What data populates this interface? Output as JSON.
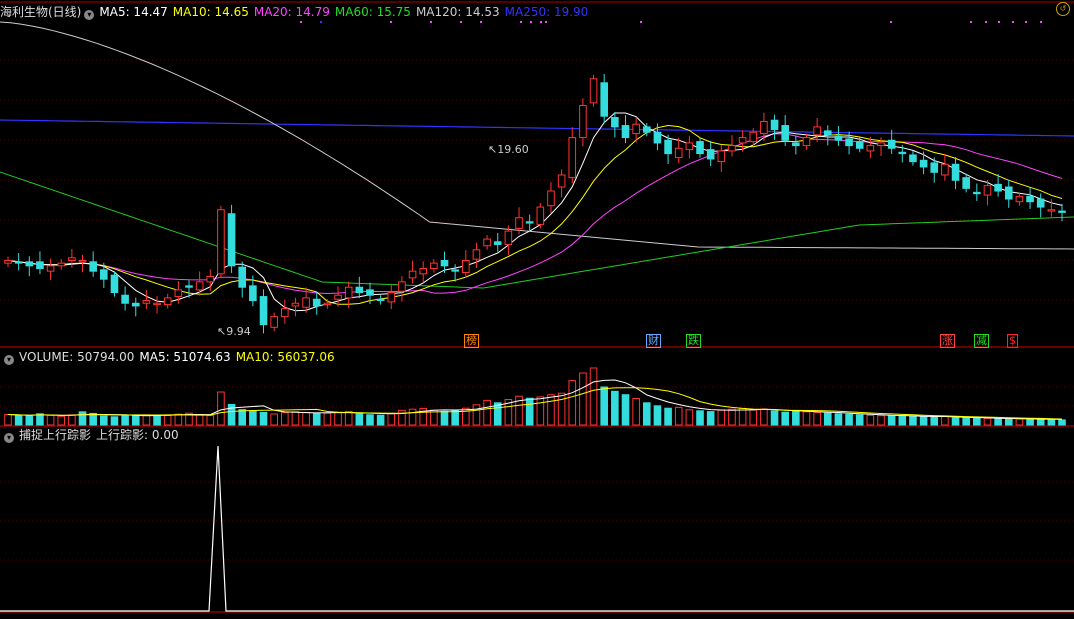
{
  "main_header": {
    "name": "海利生物(日线)",
    "ma": [
      {
        "label": "MA5: 14.47",
        "color": "#ffffff"
      },
      {
        "label": "MA10: 14.65",
        "color": "#ffff00"
      },
      {
        "label": "MA20: 14.79",
        "color": "#ff44ff"
      },
      {
        "label": "MA60: 15.75",
        "color": "#22dd22"
      },
      {
        "label": "MA120: 14.53",
        "color": "#cccccc"
      },
      {
        "label": "MA250: 19.90",
        "color": "#3333ff"
      }
    ]
  },
  "volume_header": {
    "label": "VOLUME: 50794.00",
    "ma5": "MA5: 51074.63",
    "ma10": "MA10: 56037.06"
  },
  "indicator_header": {
    "label": "捕捉上行踪影",
    "value": "上行踪影: 0.00"
  },
  "annotations": {
    "high": "19.60",
    "low": "9.94"
  },
  "markers": [
    {
      "text": "榜",
      "color": "#ff8800"
    },
    {
      "text": "财",
      "color": "#66aaff"
    },
    {
      "text": "跌",
      "color": "#22dd22"
    },
    {
      "text": "涨",
      "color": "#ff4444"
    },
    {
      "text": "减",
      "color": "#22dd22"
    },
    {
      "text": "$",
      "color": "#ff2222"
    }
  ],
  "colors": {
    "up": "#ff3333",
    "down": "#33dddd",
    "grid": "#5a0000",
    "divider": "#aa0000"
  },
  "chart_data": {
    "type": "candlestick",
    "price_range": [
      9.4,
      21.6
    ],
    "close_approx": [
      12.6,
      12.5,
      12.4,
      12.3,
      12.4,
      12.5,
      12.7,
      12.6,
      12.2,
      11.9,
      11.4,
      11.0,
      10.9,
      11.1,
      11.0,
      11.2,
      11.5,
      11.6,
      11.8,
      12.0,
      14.5,
      12.4,
      11.6,
      11.1,
      10.2,
      10.5,
      10.8,
      11.0,
      11.2,
      10.9,
      11.0,
      11.3,
      11.6,
      11.4,
      11.3,
      11.1,
      11.4,
      11.8,
      12.2,
      12.3,
      12.5,
      12.4,
      12.2,
      12.6,
      13.0,
      13.4,
      13.2,
      13.7,
      14.2,
      14.0,
      14.6,
      15.2,
      15.8,
      17.2,
      18.4,
      19.4,
      18.0,
      17.6,
      17.2,
      17.7,
      17.4,
      17.0,
      16.6,
      16.8,
      17.0,
      16.6,
      16.4,
      16.7,
      16.9,
      17.2,
      17.4,
      17.8,
      17.5,
      17.1,
      16.9,
      17.2,
      17.6,
      17.3,
      17.1,
      16.9,
      16.8,
      16.9,
      17.0,
      16.8,
      16.6,
      16.3,
      16.1,
      15.9,
      16.2,
      15.6,
      15.3,
      15.1,
      15.4,
      15.2,
      14.9,
      15.0,
      14.8,
      14.6,
      14.5,
      14.4
    ],
    "volume_approx": [
      10500,
      9800,
      8900,
      11200,
      9500,
      8700,
      10100,
      13200,
      11600,
      9000,
      8200,
      9300,
      9800,
      10200,
      10000,
      9500,
      10800,
      11800,
      10300,
      9400,
      33000,
      20500,
      15400,
      14000,
      12600,
      11000,
      12400,
      13300,
      12600,
      11400,
      11800,
      12700,
      13600,
      11000,
      10200,
      9800,
      11600,
      14700,
      15800,
      16600,
      14900,
      13600,
      14000,
      16800,
      20200,
      24600,
      22200,
      25500,
      28800,
      26800,
      28100,
      30300,
      31800,
      44400,
      52000,
      57000,
      38000,
      33700,
      30300,
      26500,
      22200,
      19200,
      16800,
      17600,
      15200,
      14200,
      13400,
      14800,
      15800,
      16600,
      15100,
      16000,
      14000,
      12800,
      13700,
      13200,
      12400,
      11800,
      11200,
      10600,
      10200,
      9700,
      9300,
      8900,
      9200,
      8600,
      8200,
      7800,
      8500,
      7300,
      6900,
      6600,
      6600,
      6300,
      6100,
      6000,
      5700,
      5600,
      5400,
      5100
    ]
  }
}
